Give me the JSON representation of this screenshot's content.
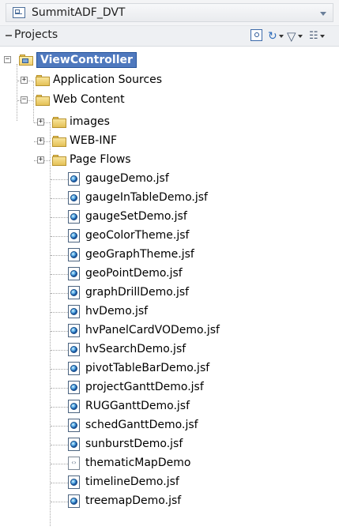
{
  "app_selector": {
    "name": "SummitADF_DVT"
  },
  "projects_panel": {
    "title": "Projects"
  },
  "tree": {
    "project": "ViewController",
    "application_sources": "Application Sources",
    "web_content": "Web Content",
    "folders": [
      "images",
      "WEB-INF",
      "Page Flows"
    ],
    "files": [
      "gaugeDemo.jsf",
      "gaugeInTableDemo.jsf",
      "gaugeSetDemo.jsf",
      "geoColorTheme.jsf",
      "geoGraphTheme.jsf",
      "geoPointDemo.jsf",
      "graphDrillDemo.jsf",
      "hvDemo.jsf",
      "hvPanelCardVODemo.jsf",
      "hvSearchDemo.jsf",
      "pivotTableBarDemo.jsf",
      "projectGanttDemo.jsf",
      "RUGGanttDemo.jsf",
      "schedGanttDemo.jsf",
      "sunburstDemo.jsf",
      "thematicMapDemo",
      "timelineDemo.jsf",
      "treemapDemo.jsf"
    ]
  },
  "colors": {
    "selection": "#4f79be",
    "folder": "#e4c157"
  }
}
